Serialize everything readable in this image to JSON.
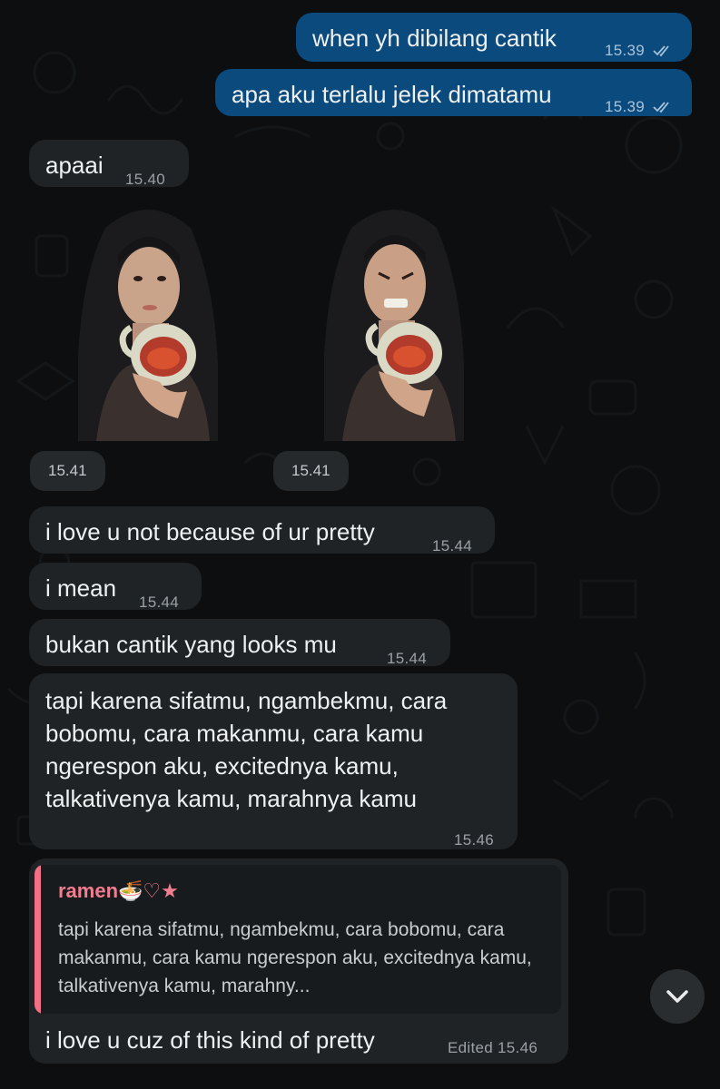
{
  "messages": [
    {
      "text": "when yh dibilang cantik",
      "time": "15.39"
    },
    {
      "text": "apa aku terlalu jelek dimatamu",
      "time": "15.39"
    },
    {
      "text": "apaai",
      "time": "15.40"
    },
    {
      "text": "i love u not because of ur pretty",
      "time": "15.44"
    },
    {
      "text": "i mean",
      "time": "15.44"
    },
    {
      "text": "bukan cantik yang looks mu",
      "time": "15.44"
    },
    {
      "text": "tapi karena sifatmu, ngambekmu, cara bobomu, cara makanmu, cara kamu ngerespon aku, excitednya kamu, talkativenya kamu, marahnya kamu",
      "time": "15.46"
    }
  ],
  "stickers": [
    {
      "time": "15.41"
    },
    {
      "time": "15.41"
    }
  ],
  "reply": {
    "quoted_name": "ramen🍜♡★",
    "quoted_text": "tapi karena sifatmu, ngambekmu, cara bobomu, cara makanmu, cara kamu ngerespon aku, excitednya kamu, talkativenya kamu, marahny...",
    "text": "i love u cuz of this kind of pretty",
    "edited_label": "Edited",
    "time": "15.46"
  },
  "colors": {
    "outgoing_bubble": "#0b4a7d",
    "incoming_bubble": "#1f2326",
    "quote_accent": "#f26f85",
    "background": "#0c0e0f"
  },
  "icons": [
    "double-check-icon",
    "chevron-down-icon"
  ]
}
